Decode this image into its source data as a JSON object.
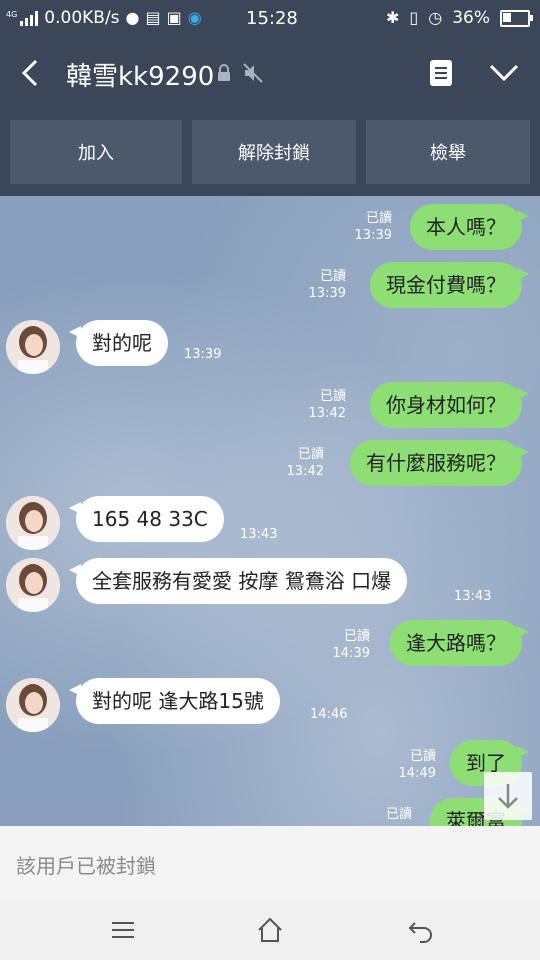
{
  "status": {
    "network": "4G",
    "speed": "0.00KB/s",
    "time": "15:28",
    "battery": "36%",
    "battery_level": 0.36
  },
  "header": {
    "title": "韓雪kk9290",
    "icons": [
      "back-arrow-icon",
      "lock-icon",
      "mute-icon",
      "note-icon",
      "chevron-down-icon"
    ]
  },
  "actions": {
    "add": "加入",
    "unblock": "解除封鎖",
    "report": "檢舉"
  },
  "messages": [
    {
      "dir": "out",
      "text": "本人嗎？",
      "read": "已讀",
      "time": "13:39"
    },
    {
      "dir": "out",
      "text": "現金付費嗎？",
      "read": "已讀",
      "time": "13:39"
    },
    {
      "dir": "in",
      "text": "對的呢",
      "time": "13:39"
    },
    {
      "dir": "out",
      "text": "你身材如何？",
      "read": "已讀",
      "time": "13:42"
    },
    {
      "dir": "out",
      "text": "有什麼服務呢？",
      "read": "已讀",
      "time": "13:42"
    },
    {
      "dir": "in",
      "text": "165  48  33C",
      "time": "13:43"
    },
    {
      "dir": "in",
      "text": "全套服務有愛愛 按摩 鴛鴦浴  口爆",
      "time": "13:43"
    },
    {
      "dir": "out",
      "text": "逢大路嗎？",
      "read": "已讀",
      "time": "14:39"
    },
    {
      "dir": "in",
      "text": "對的呢  逢大路15號",
      "time": "14:46"
    },
    {
      "dir": "out",
      "text": "到了",
      "read": "已讀",
      "time": "14:49"
    },
    {
      "dir": "out",
      "text": "萊爾富",
      "read": "已讀",
      "time": ""
    }
  ],
  "blocked_text": "該用戶已被封鎖",
  "colors": {
    "bar": "#3b4658",
    "button": "#4c586c",
    "bubble_out": "#8ddf75",
    "bubble_in": "#ffffff",
    "chat_bg": "#889fbd"
  }
}
